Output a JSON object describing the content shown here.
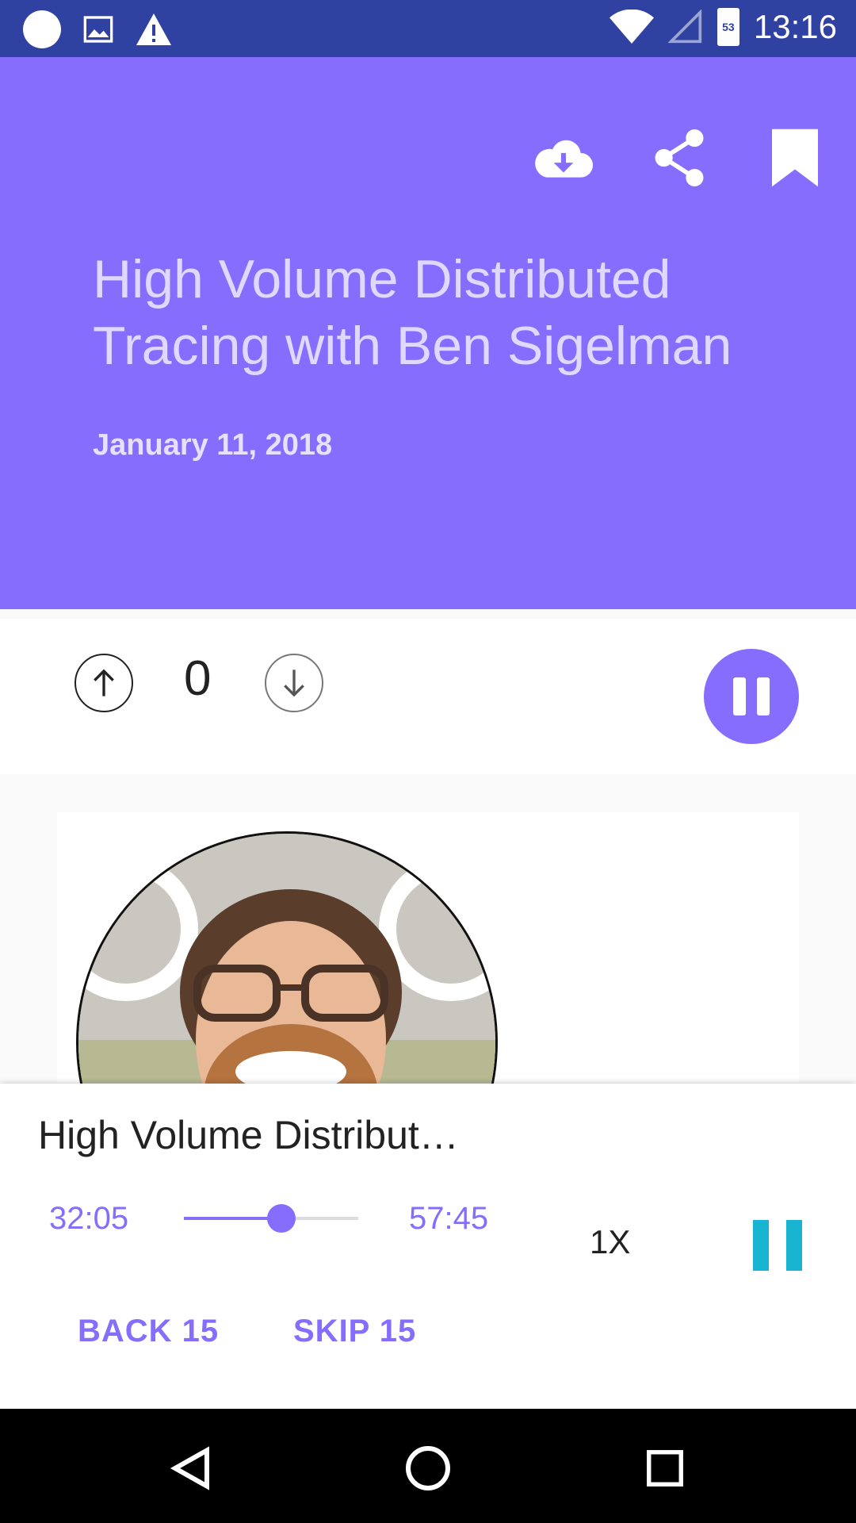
{
  "statusbar": {
    "time": "13:16",
    "battery_level": "53"
  },
  "header": {
    "title": "High Volume Distributed Tracing with Ben Sigelman",
    "date": "January 11, 2018",
    "accent": "#866dfd"
  },
  "votes": {
    "count": "0"
  },
  "player": {
    "title": "High Volume Distribut…",
    "elapsed": "32:05",
    "total": "57:45",
    "progress_fraction": 0.56,
    "speed": "1X",
    "back_label": "BACK 15",
    "skip_label": "SKIP 15",
    "pause_color": "#18b4d1"
  }
}
